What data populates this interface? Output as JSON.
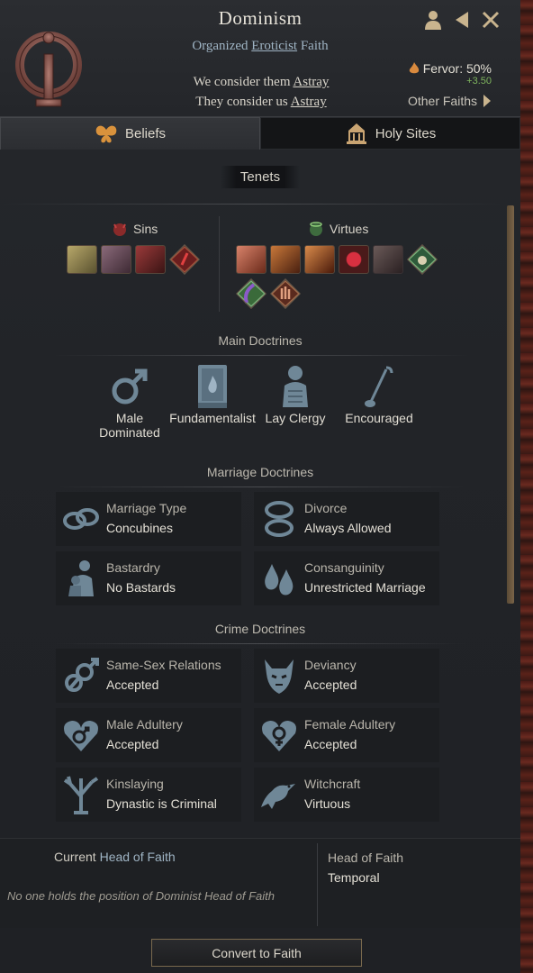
{
  "header": {
    "title": "Dominism",
    "subtitle_prefix": "Organized ",
    "subtitle_link": "Eroticist",
    "subtitle_suffix": " Faith",
    "we_consider_prefix": "We consider them ",
    "we_consider_value": "Astray",
    "they_consider_prefix": "They consider us ",
    "they_consider_value": "Astray",
    "fervor_label": "Fervor: 50%",
    "fervor_delta": "+3.50",
    "other_faiths_label": "Other Faiths",
    "icons": [
      "character-icon",
      "back-arrow-icon",
      "close-icon"
    ]
  },
  "tabs": [
    {
      "label": "Beliefs",
      "icon": "butterfly-icon",
      "active": true
    },
    {
      "label": "Holy Sites",
      "icon": "temple-icon",
      "active": false
    }
  ],
  "tenets": {
    "title": "Tenets",
    "sins_label": "Sins",
    "virtues_label": "Virtues",
    "sins": [
      "sin-trait-1",
      "sin-trait-2",
      "sin-trait-3",
      "sin-trait-4"
    ],
    "virtues": [
      "virtue-trait-1",
      "virtue-trait-2",
      "virtue-trait-3",
      "virtue-trait-4",
      "virtue-trait-5",
      "virtue-trait-6",
      "virtue-trait-7",
      "virtue-trait-8"
    ]
  },
  "main_doctrines": {
    "title": "Main Doctrines",
    "items": [
      {
        "label_line1": "Male",
        "label_line2": "Dominated",
        "icon": "male-symbol-icon"
      },
      {
        "label_line1": "Fundamentalist",
        "label_line2": "",
        "icon": "holy-book-icon"
      },
      {
        "label_line1": "Lay Clergy",
        "label_line2": "",
        "icon": "clergy-icon"
      },
      {
        "label_line1": "Encouraged",
        "label_line2": "",
        "icon": "pilgrim-staff-icon"
      }
    ]
  },
  "marriage_doctrines": {
    "title": "Marriage Doctrines",
    "items": [
      {
        "key": "Marriage Type",
        "value": "Concubines",
        "icon": "rings-icon"
      },
      {
        "key": "Divorce",
        "value": "Always Allowed",
        "icon": "broken-ring-icon"
      },
      {
        "key": "Bastardry",
        "value": "No Bastards",
        "icon": "child-icon"
      },
      {
        "key": "Consanguinity",
        "value": "Unrestricted Marriage",
        "icon": "blood-drops-icon"
      }
    ]
  },
  "crime_doctrines": {
    "title": "Crime Doctrines",
    "items": [
      {
        "key": "Same-Sex Relations",
        "value": "Accepted",
        "icon": "male-male-icon"
      },
      {
        "key": "Deviancy",
        "value": "Accepted",
        "icon": "demon-mask-icon"
      },
      {
        "key": "Male Adultery",
        "value": "Accepted",
        "icon": "male-heart-icon"
      },
      {
        "key": "Female Adultery",
        "value": "Accepted",
        "icon": "female-heart-icon"
      },
      {
        "key": "Kinslaying",
        "value": "Dynastic is Criminal",
        "icon": "family-tree-icon"
      },
      {
        "key": "Witchcraft",
        "value": "Virtuous",
        "icon": "raven-icon"
      }
    ]
  },
  "head_of_faith": {
    "title_prefix": "Current ",
    "title_highlight": "Head of Faith",
    "empty_text": "No one holds the position of Dominist Head of Faith",
    "type_label": "Head of Faith",
    "type_value": "Temporal"
  },
  "convert_button": "Convert to Faith",
  "colors": {
    "accent_blue": "#9fb4c4",
    "fervor_green": "#7fb55e",
    "icon_slate": "#6f8797",
    "button_border": "#7a6a4e"
  }
}
